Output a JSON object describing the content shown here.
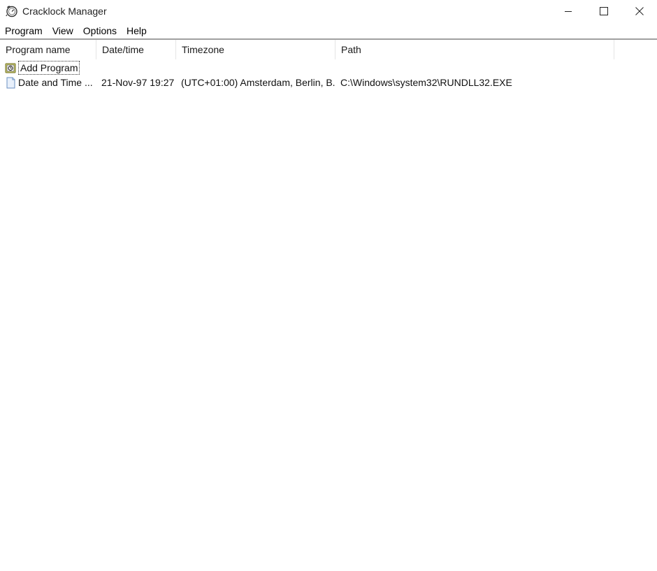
{
  "window": {
    "title": "Cracklock Manager",
    "icon": "cracklock-clock-icon",
    "controls": {
      "minimize": "minimize-icon",
      "maximize": "maximize-icon",
      "close": "close-icon"
    }
  },
  "menu": {
    "items": [
      {
        "label": "Program"
      },
      {
        "label": "View"
      },
      {
        "label": "Options"
      },
      {
        "label": "Help"
      }
    ]
  },
  "list": {
    "columns": [
      {
        "label": "Program name"
      },
      {
        "label": "Date/time"
      },
      {
        "label": "Timezone"
      },
      {
        "label": "Path"
      }
    ],
    "rows": [
      {
        "icon": "add-program-icon",
        "name": "Add Program",
        "datetime": "",
        "timezone": "",
        "path": "",
        "focused": true
      },
      {
        "icon": "document-icon",
        "name": "Date and Time ...",
        "datetime": "21-Nov-97 19:27",
        "timezone": "(UTC+01:00) Amsterdam, Berlin, B...",
        "path": "C:\\Windows\\system32\\RUNDLL32.EXE",
        "focused": false
      }
    ]
  }
}
